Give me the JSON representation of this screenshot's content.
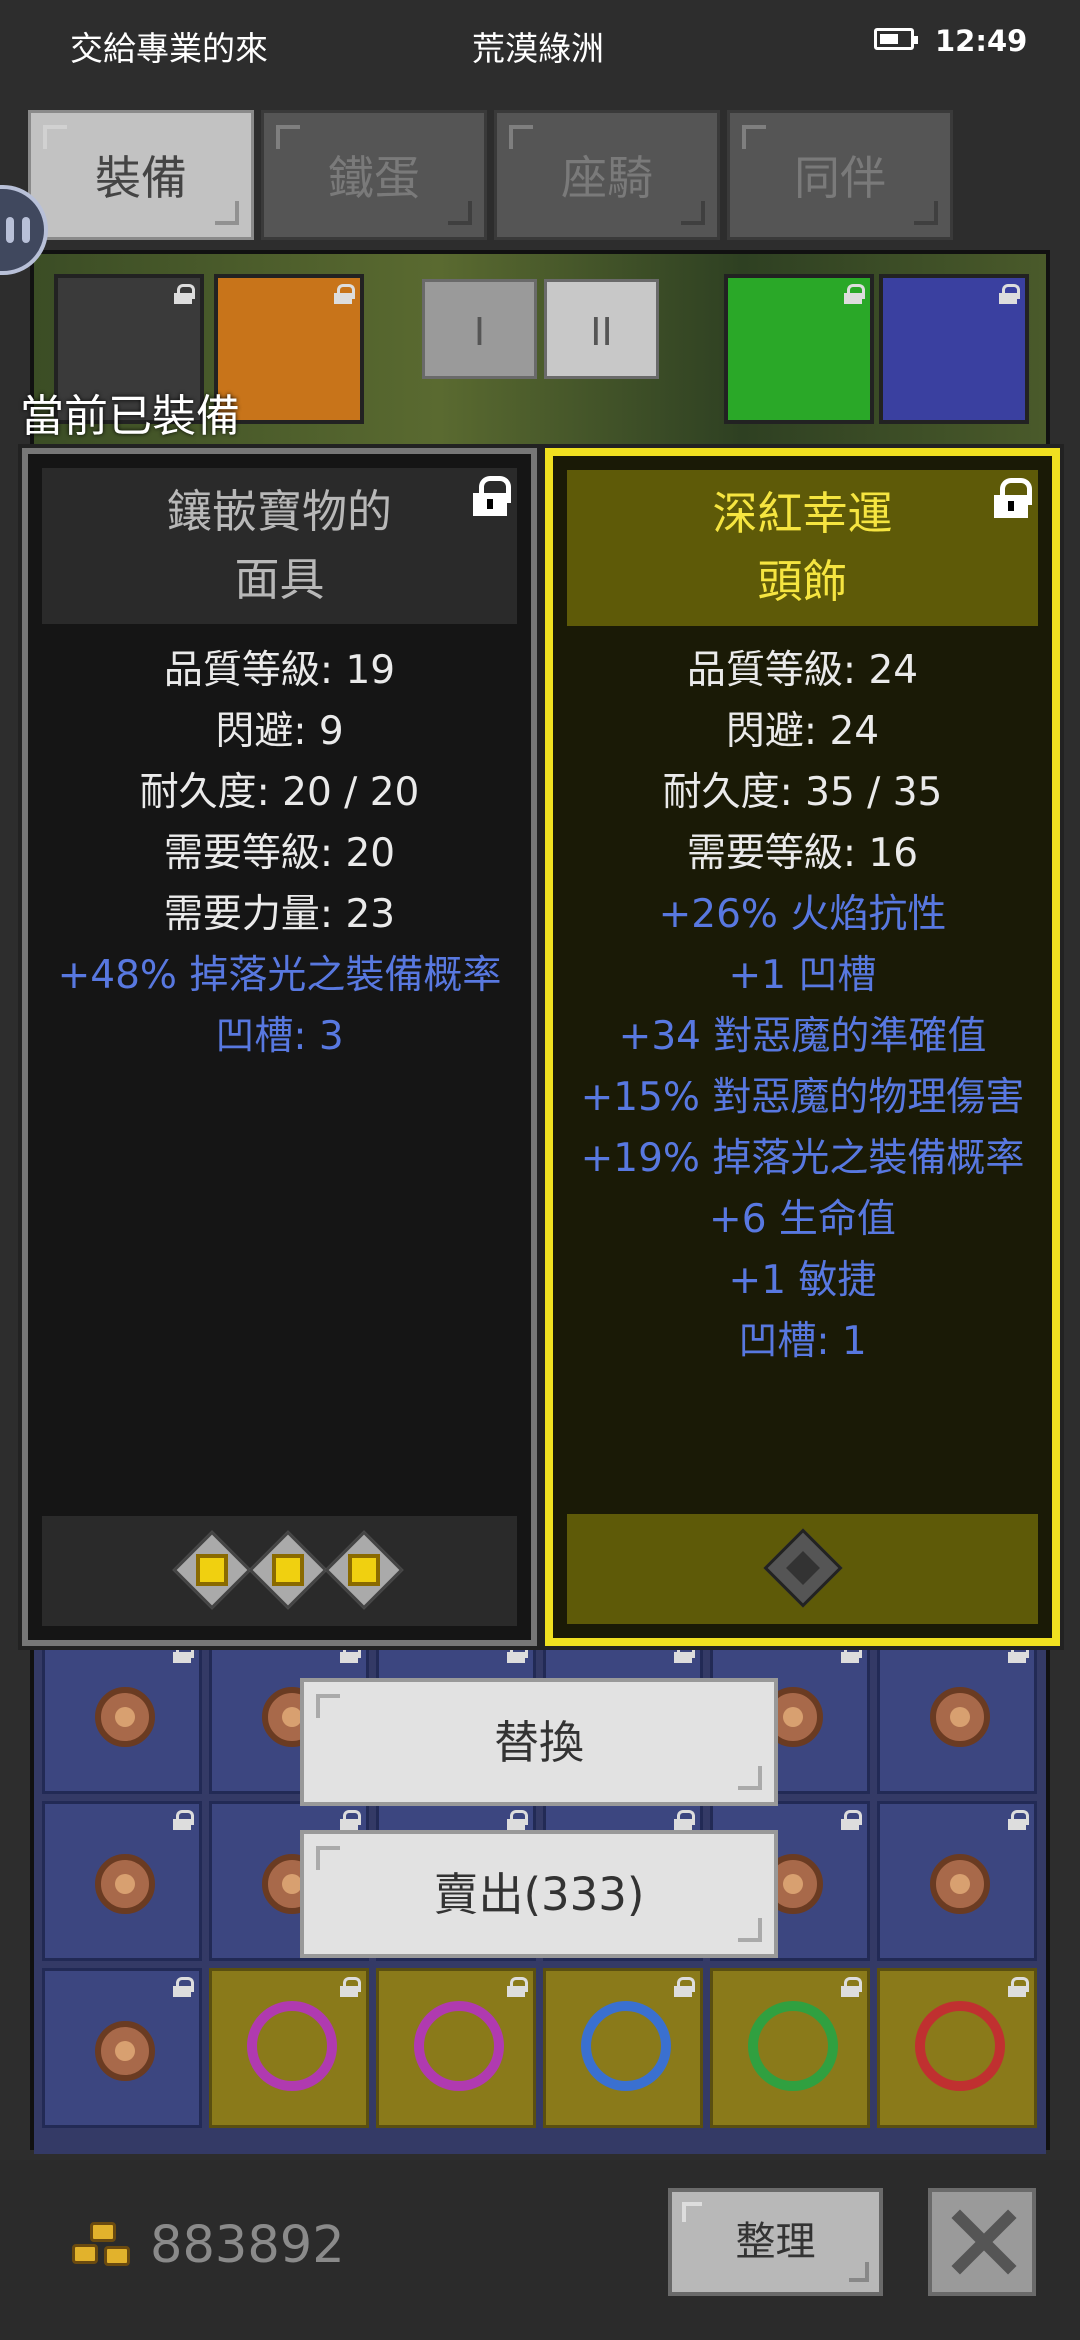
{
  "status_bar": {
    "left_text": "交給專業的來",
    "center_text": "荒漠綠洲",
    "time": "12:49",
    "battery_icon": "battery-icon"
  },
  "tabs": [
    {
      "label": "裝備",
      "active": true
    },
    {
      "label": "鐵蛋",
      "active": false
    },
    {
      "label": "座騎",
      "active": false
    },
    {
      "label": "同伴",
      "active": false
    }
  ],
  "page_toggle": {
    "one": "I",
    "two": "II"
  },
  "equipped_label": "當前已裝備",
  "left_card": {
    "name_line1": "鑲嵌寶物的",
    "name_line2": "面具",
    "stats": [
      {
        "text": "品質等級: 19",
        "kind": "base"
      },
      {
        "text": "閃避: 9",
        "kind": "base"
      },
      {
        "text": "耐久度: 20 / 20",
        "kind": "base"
      },
      {
        "text": "需要等級: 20",
        "kind": "base"
      },
      {
        "text": "需要力量: 23",
        "kind": "base"
      },
      {
        "text": "+48% 掉落光之裝備概率",
        "kind": "magic"
      },
      {
        "text": "凹槽: 3",
        "kind": "magic"
      }
    ],
    "sockets": [
      "yellow-gem",
      "yellow-gem",
      "yellow-gem"
    ],
    "locked": true
  },
  "right_card": {
    "name_line1": "深紅幸運",
    "name_line2": "頭飾",
    "stats": [
      {
        "text": "品質等級: 24",
        "kind": "base"
      },
      {
        "text": "閃避: 24",
        "kind": "base"
      },
      {
        "text": "耐久度: 35 / 35",
        "kind": "base"
      },
      {
        "text": "需要等級: 16",
        "kind": "base"
      },
      {
        "text": "+26% 火焰抗性",
        "kind": "magic"
      },
      {
        "text": "+1 凹槽",
        "kind": "magic"
      },
      {
        "text": "+34 對惡魔的準確值",
        "kind": "magic"
      },
      {
        "text": "+15% 對惡魔的物理傷害",
        "kind": "magic"
      },
      {
        "text": "+19% 掉落光之裝備概率",
        "kind": "magic"
      },
      {
        "text": "+6 生命值",
        "kind": "magic"
      },
      {
        "text": "+1 敏捷",
        "kind": "magic"
      },
      {
        "text": "凹槽: 1",
        "kind": "magic"
      }
    ],
    "sockets": [
      "empty-socket"
    ],
    "locked": true
  },
  "actions": {
    "replace_label": "替換",
    "sell_label": "賣出(333)"
  },
  "bottom": {
    "gold_amount": "883892",
    "sort_label": "整理",
    "close_icon": "close-icon"
  },
  "colors": {
    "magic_text": "#5878e0",
    "unique_title": "#f6e540",
    "selected_border": "#f0e020"
  }
}
